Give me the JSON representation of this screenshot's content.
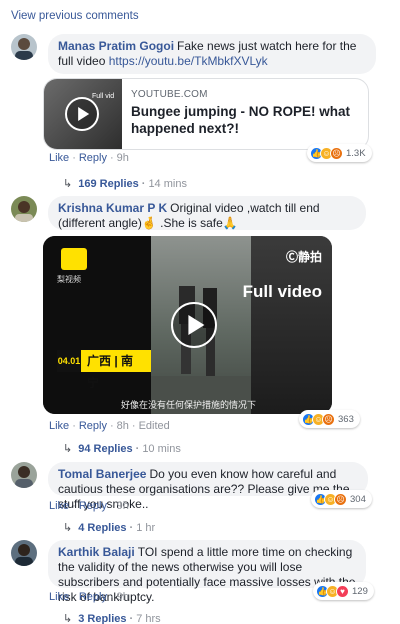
{
  "view_previous": "View previous comments",
  "actions": {
    "like": "Like",
    "reply": "Reply"
  },
  "comments": [
    {
      "author": "Manas Pratim Gogoi",
      "text": "Fake news just watch here for the full video",
      "link": "https://youtu.be/TkMbkfXVLyk",
      "age": "9h",
      "reactions": {
        "icons": [
          "like-icon",
          "haha-icon",
          "angry-icon"
        ],
        "count": "1.3K"
      },
      "replies": "169 Replies",
      "replies_age": "14 mins",
      "attachment": {
        "domain": "YOUTUBE.COM",
        "title": "Bungee jumping - NO ROPE! what happened next?!",
        "thumb_label": "Full vid"
      }
    },
    {
      "author": "Krishna Kumar P K",
      "text": "Original video ,watch till end (different angle)🤞 .She is safe🙏",
      "age": "8h",
      "edited": "Edited",
      "reactions": {
        "icons": [
          "like-icon",
          "haha-icon",
          "angry-icon"
        ],
        "count": "363"
      },
      "replies": "94 Replies",
      "replies_age": "10 mins",
      "video": {
        "logo_text": "梨视频",
        "brand": "Ⓒ静拍",
        "overlay": "Full video",
        "loc_num": "04.01",
        "location": "广西 | 南宁",
        "subtitle": "好像在没有任何保护措施的情况下"
      }
    },
    {
      "author": "Tomal Banerjee",
      "text": "Do you even know how careful and cautious these organisations are?? Please give me the stuff you smoke..",
      "age": "9h",
      "reactions": {
        "icons": [
          "like-icon",
          "haha-icon",
          "angry-icon"
        ],
        "count": "304"
      },
      "replies": "4 Replies",
      "replies_age": "1 hr"
    },
    {
      "author": "Karthik Balaji",
      "text": "TOI spend a little more time on checking the validity of the news otherwise you will lose subscribers and potentially face massive losses with the risk of bankruptcy.",
      "age": "9h",
      "reactions": {
        "icons": [
          "like-icon",
          "haha-icon",
          "love-icon"
        ],
        "count": "129"
      },
      "replies": "3 Replies",
      "replies_age": "7 hrs"
    }
  ],
  "colors": {
    "link": "#385898",
    "bubble": "#f2f3f5",
    "meta": "#90949c",
    "like": "#1877f2",
    "haha": "#f7b125",
    "angry": "#e9710f",
    "love": "#f33e58"
  }
}
